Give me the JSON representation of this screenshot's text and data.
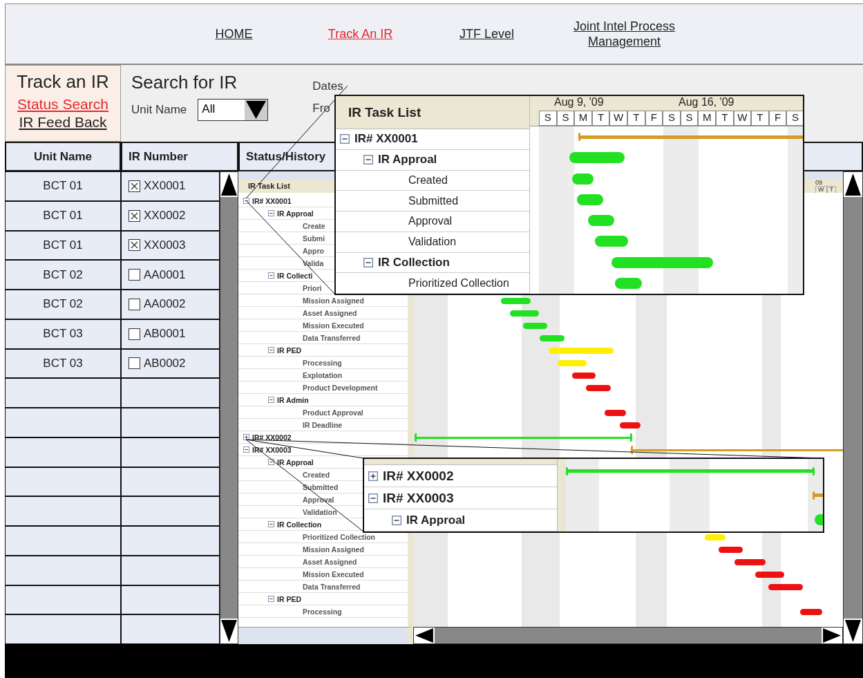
{
  "nav": [
    {
      "label": "HOME",
      "selected": false
    },
    {
      "label": "Track An IR",
      "selected": true
    },
    {
      "label": "JTF Level",
      "selected": false
    },
    {
      "label": "Joint Intel Process Management",
      "selected": false
    }
  ],
  "side_panel": {
    "title": "Track an IR",
    "links": [
      {
        "label": "Status Search",
        "selected": true
      },
      {
        "label": "IR Feed Back",
        "selected": false
      }
    ]
  },
  "search": {
    "title": "Search for IR",
    "unit_name": {
      "label": "Unit Name",
      "value": "All"
    },
    "dates_label": "Dates",
    "from_label": "Fro"
  },
  "table": {
    "columns": [
      "Unit Name",
      "IR Number",
      "Status/History"
    ],
    "rows": [
      {
        "unit": "BCT 01",
        "ir_number": "XX0001",
        "checked": true
      },
      {
        "unit": "BCT 01",
        "ir_number": "XX0002",
        "checked": true
      },
      {
        "unit": "BCT 01",
        "ir_number": "XX0003",
        "checked": true
      },
      {
        "unit": "BCT 02",
        "ir_number": "AA0001",
        "checked": false
      },
      {
        "unit": "BCT 02",
        "ir_number": "AA0002",
        "checked": false
      },
      {
        "unit": "BCT 03",
        "ir_number": "AB0001",
        "checked": false
      },
      {
        "unit": "BCT 03",
        "ir_number": "AB0002",
        "checked": false
      }
    ]
  },
  "status": {
    "task_list_header": "IR Task List",
    "timeline_header": {
      "year": "09",
      "days": [
        "W",
        "T"
      ]
    },
    "tasks": [
      {
        "label": "IR# XX0001",
        "expanded": true,
        "children": [
          {
            "label": "IR Approal",
            "expanded": true,
            "children": [
              {
                "label": "Create"
              },
              {
                "label": "Submi"
              },
              {
                "label": "Appro"
              },
              {
                "label": "Valida"
              }
            ]
          },
          {
            "label": "IR Collecti",
            "expanded": true,
            "children": [
              {
                "label": "Priori"
              },
              {
                "label": "Mission Assigned",
                "color": "#22e022"
              },
              {
                "label": "Asset Assigned",
                "color": "#22e022"
              },
              {
                "label": "Mission Executed",
                "color": "#22e022"
              },
              {
                "label": "Data Transferred",
                "color": "#22e022"
              }
            ]
          },
          {
            "label": "IR PED",
            "expanded": true,
            "color": "#ffee00",
            "children": [
              {
                "label": "Processing",
                "color": "#ffee00"
              },
              {
                "label": "Explotation",
                "color": "#ee1111"
              },
              {
                "label": "Product Development",
                "color": "#ee1111"
              }
            ]
          },
          {
            "label": "IR Admin",
            "expanded": true,
            "children": [
              {
                "label": "Product Approval",
                "color": "#ee1111"
              },
              {
                "label": "IR Deadline",
                "color": "#ee1111"
              }
            ]
          }
        ]
      },
      {
        "label": "IR# XX0002",
        "expanded": false,
        "color": "#22e022"
      },
      {
        "label": "IR# XX0003",
        "expanded": true,
        "color": "#d89a20",
        "children": [
          {
            "label": "IR Approal",
            "expanded": true,
            "children": [
              {
                "label": "Created"
              },
              {
                "label": "Submitted"
              },
              {
                "label": "Approval"
              },
              {
                "label": "Validation"
              }
            ]
          },
          {
            "label": "IR Collection",
            "expanded": true,
            "children": [
              {
                "label": "Prioritized Collection",
                "color": "#ffee00"
              },
              {
                "label": "Mission Assigned",
                "color": "#ee1111"
              },
              {
                "label": "Asset Assigned",
                "color": "#ee1111"
              },
              {
                "label": "Mission Executed",
                "color": "#ee1111"
              },
              {
                "label": "Data Transferred",
                "color": "#ee1111"
              }
            ]
          },
          {
            "label": "IR PED",
            "expanded": true,
            "children": [
              {
                "label": "Processing",
                "color": "#ee1111"
              }
            ]
          }
        ]
      }
    ]
  },
  "zoom_callouts": [
    {
      "header": "IR Task List",
      "weeks": [
        "Aug 9, '09",
        "Aug 16, '09"
      ],
      "days": [
        "S",
        "S",
        "M",
        "T",
        "W",
        "T",
        "F",
        "S",
        "S",
        "M",
        "T",
        "W",
        "T",
        "F",
        "S"
      ],
      "tasks": [
        {
          "label": "IR# XX0001",
          "expanded": true,
          "color": "#d89a20",
          "children": [
            {
              "label": "IR Approal",
              "expanded": true,
              "color": "#22e022",
              "children": [
                {
                  "label": "Created",
                  "color": "#22e022"
                },
                {
                  "label": "Submitted",
                  "color": "#22e022"
                },
                {
                  "label": "Approval",
                  "color": "#22e022"
                },
                {
                  "label": "Validation",
                  "color": "#22e022"
                }
              ]
            },
            {
              "label": "IR Collection",
              "expanded": true,
              "color": "#22e022",
              "children": [
                {
                  "label": "Prioritized Collection",
                  "color": "#22e022"
                }
              ]
            }
          ]
        }
      ]
    },
    {
      "tasks": [
        {
          "label": "IR# XX0002",
          "expanded": false,
          "color": "#22e022"
        },
        {
          "label": "IR# XX0003",
          "expanded": true,
          "color": "#d89a20",
          "children": [
            {
              "label": "IR Approal",
              "expanded": true,
              "color": "#22e022"
            }
          ]
        }
      ]
    }
  ]
}
